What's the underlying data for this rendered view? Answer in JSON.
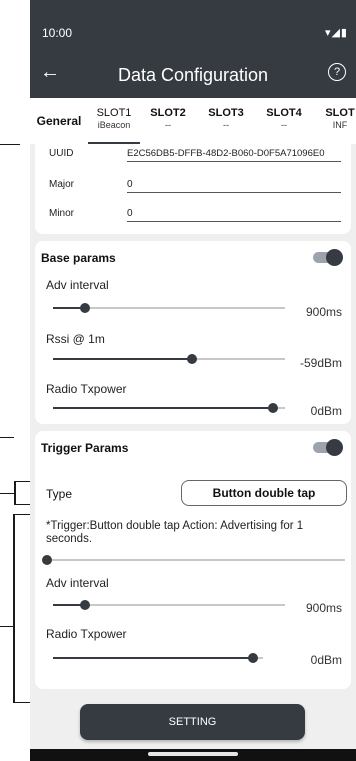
{
  "status_bar": {
    "time": "10:00",
    "icons": "▾◢▮"
  },
  "app_bar": {
    "title": "Data Configuration",
    "back_icon": "arrow-back-icon",
    "help_icon": "help-circle-icon"
  },
  "tabs": [
    {
      "label": "General",
      "sub": ""
    },
    {
      "label": "SLOT1",
      "sub": "iBeacon"
    },
    {
      "label": "SLOT2",
      "sub": "--"
    },
    {
      "label": "SLOT3",
      "sub": "--"
    },
    {
      "label": "SLOT4",
      "sub": "--"
    },
    {
      "label": "SLOT",
      "sub": "INF"
    }
  ],
  "ibeacon": {
    "uuid_label": "UUID",
    "uuid_value": "E2C56DB5-DFFB-48D2-B060-D0F5A71096E0",
    "major_label": "Major",
    "major_value": "0",
    "minor_label": "Minor",
    "minor_value": "0"
  },
  "base_params": {
    "title": "Base params",
    "toggle_on": true,
    "adv_interval": {
      "label": "Adv interval",
      "value": "900ms",
      "level": 0.14
    },
    "rssi": {
      "label": "Rssi @ 1m",
      "value": "-59dBm",
      "level": 0.6
    },
    "tx_power": {
      "label": "Radio Txpower",
      "value": "0dBm",
      "level": 0.95
    }
  },
  "trigger_params": {
    "title": "Trigger Params",
    "toggle_on": true,
    "type_label": "Type",
    "type_value": "Button double tap",
    "description": "*Trigger:Button double tap  Action: Advertising for 1 seconds.",
    "duration_level": 0.0,
    "adv_interval": {
      "label": "Adv interval",
      "value": "900ms",
      "level": 0.14
    },
    "tx_power": {
      "label": "Radio Txpower",
      "value": "0dBm",
      "level": 0.95
    }
  },
  "setting_button": {
    "label": "SETTING"
  },
  "colors": {
    "primary": "#363b42",
    "background": "#efefef",
    "track": "#c8c8c8"
  }
}
